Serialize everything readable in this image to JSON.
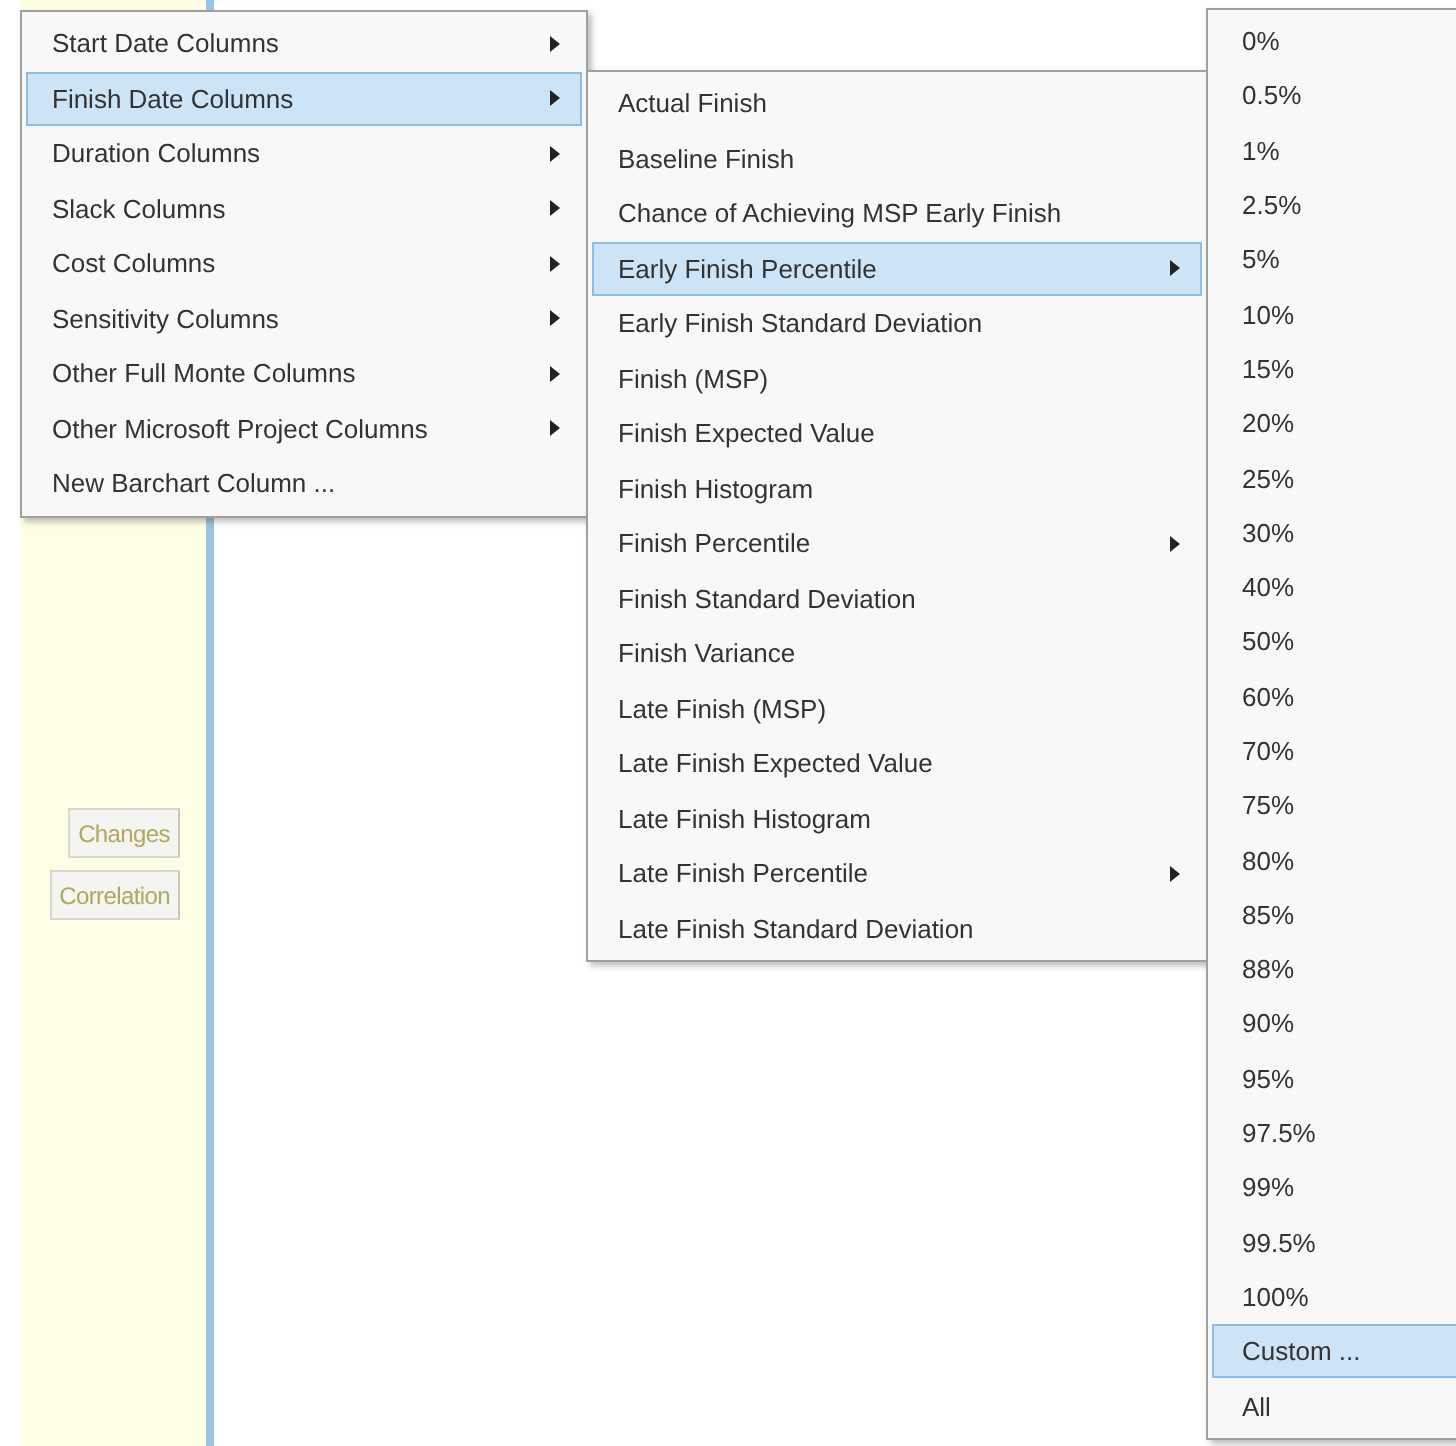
{
  "background_panel": {
    "buttons": [
      {
        "label": "Changes"
      },
      {
        "label": "Correlation"
      }
    ]
  },
  "column_menu": {
    "items": [
      {
        "label": "Start Date Columns",
        "has_submenu": true,
        "selected": false
      },
      {
        "label": "Finish Date Columns",
        "has_submenu": true,
        "selected": true
      },
      {
        "label": "Duration Columns",
        "has_submenu": true,
        "selected": false
      },
      {
        "label": "Slack Columns",
        "has_submenu": true,
        "selected": false
      },
      {
        "label": "Cost Columns",
        "has_submenu": true,
        "selected": false
      },
      {
        "label": "Sensitivity Columns",
        "has_submenu": true,
        "selected": false
      },
      {
        "label": "Other Full Monte Columns",
        "has_submenu": true,
        "selected": false
      },
      {
        "label": "Other Microsoft Project Columns",
        "has_submenu": true,
        "selected": false
      },
      {
        "label": "New Barchart Column ...",
        "has_submenu": false,
        "selected": false
      }
    ]
  },
  "finish_date_menu": {
    "items": [
      {
        "label": "Actual Finish",
        "has_submenu": false,
        "selected": false
      },
      {
        "label": "Baseline Finish",
        "has_submenu": false,
        "selected": false
      },
      {
        "label": "Chance of Achieving MSP Early Finish",
        "has_submenu": false,
        "selected": false
      },
      {
        "label": "Early Finish Percentile",
        "has_submenu": true,
        "selected": true
      },
      {
        "label": "Early Finish Standard Deviation",
        "has_submenu": false,
        "selected": false
      },
      {
        "label": "Finish (MSP)",
        "has_submenu": false,
        "selected": false
      },
      {
        "label": "Finish Expected Value",
        "has_submenu": false,
        "selected": false
      },
      {
        "label": "Finish Histogram",
        "has_submenu": false,
        "selected": false
      },
      {
        "label": "Finish Percentile",
        "has_submenu": true,
        "selected": false
      },
      {
        "label": "Finish Standard Deviation",
        "has_submenu": false,
        "selected": false
      },
      {
        "label": "Finish Variance",
        "has_submenu": false,
        "selected": false
      },
      {
        "label": "Late Finish (MSP)",
        "has_submenu": false,
        "selected": false
      },
      {
        "label": "Late Finish Expected Value",
        "has_submenu": false,
        "selected": false
      },
      {
        "label": "Late Finish Histogram",
        "has_submenu": false,
        "selected": false
      },
      {
        "label": "Late Finish Percentile",
        "has_submenu": true,
        "selected": false
      },
      {
        "label": "Late Finish Standard Deviation",
        "has_submenu": false,
        "selected": false
      }
    ]
  },
  "percentile_menu": {
    "items": [
      {
        "label": "0%",
        "selected": false
      },
      {
        "label": "0.5%",
        "selected": false
      },
      {
        "label": "1%",
        "selected": false
      },
      {
        "label": "2.5%",
        "selected": false
      },
      {
        "label": "5%",
        "selected": false
      },
      {
        "label": "10%",
        "selected": false
      },
      {
        "label": "15%",
        "selected": false
      },
      {
        "label": "20%",
        "selected": false
      },
      {
        "label": "25%",
        "selected": false
      },
      {
        "label": "30%",
        "selected": false
      },
      {
        "label": "40%",
        "selected": false
      },
      {
        "label": "50%",
        "selected": false
      },
      {
        "label": "60%",
        "selected": false
      },
      {
        "label": "70%",
        "selected": false
      },
      {
        "label": "75%",
        "selected": false
      },
      {
        "label": "80%",
        "selected": false
      },
      {
        "label": "85%",
        "selected": false
      },
      {
        "label": "88%",
        "selected": false
      },
      {
        "label": "90%",
        "selected": false
      },
      {
        "label": "95%",
        "selected": false
      },
      {
        "label": "97.5%",
        "selected": false
      },
      {
        "label": "99%",
        "selected": false
      },
      {
        "label": "99.5%",
        "selected": false
      },
      {
        "label": "100%",
        "selected": false
      },
      {
        "label": "Custom ...",
        "selected": true
      },
      {
        "label": "All",
        "selected": false
      }
    ]
  }
}
